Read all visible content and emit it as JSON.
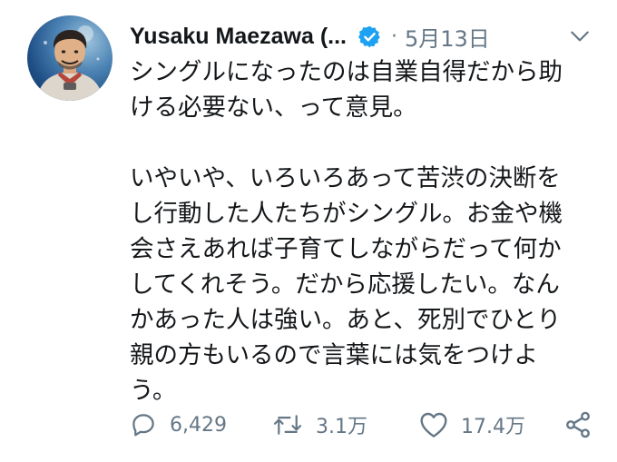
{
  "tweet": {
    "author_name": "Yusaku Maezawa (...",
    "separator": "·",
    "date": "5月13日",
    "verified_icon": "verified-badge-icon",
    "accent_color": "#1da1f2",
    "text_color": "#14171a",
    "muted_color": "#657786",
    "paragraphs": [
      [
        "シングルになったのは自業自得だから助",
        "ける必要ない、って意見。"
      ],
      [
        "いやいや、いろいろあって苦渋の決断を",
        "し行動した人たちがシングル。お金や機",
        "会さえあれば子育てしながらだって何か",
        "してくれそう。だから応援したい。なん",
        "かあった人は強い。あと、死別でひとり",
        "親の方もいるので言葉には気をつけよ",
        "う。"
      ]
    ],
    "actions": {
      "reply": {
        "icon": "reply-icon",
        "count": "6,429"
      },
      "retweet": {
        "icon": "retweet-icon",
        "count": "3.1万"
      },
      "like": {
        "icon": "heart-icon",
        "count": "17.4万"
      },
      "share": {
        "icon": "share-icon"
      }
    }
  }
}
